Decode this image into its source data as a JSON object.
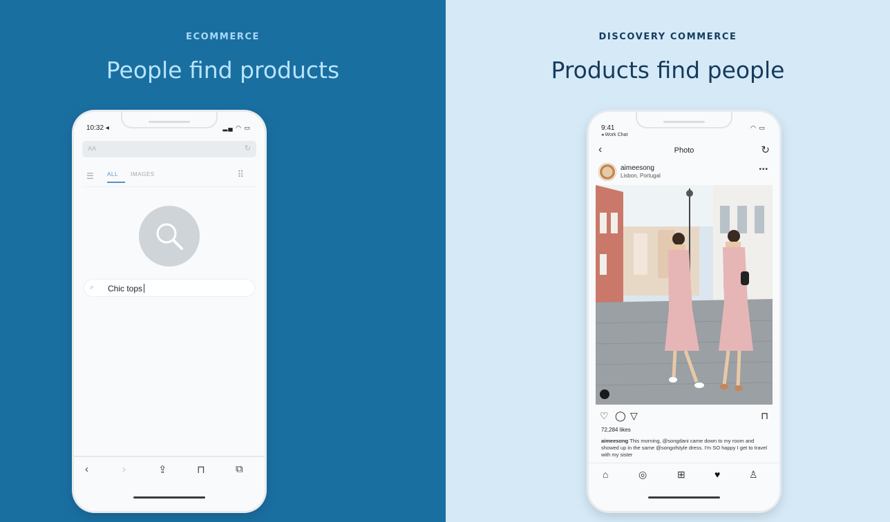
{
  "left_panel": {
    "eyebrow": "ECOMMERCE",
    "headline": "People find products",
    "phone": {
      "time": "10:32",
      "url_text": "AA",
      "tab_all": "ALL",
      "tab_images": "IMAGES",
      "query": "Chic tops"
    }
  },
  "right_panel": {
    "eyebrow": "DISCOVERY COMMERCE",
    "headline": "Products find people",
    "phone": {
      "time": "9:41",
      "back_link": "◂ Work Chat",
      "title": "Photo",
      "username": "aimeesong",
      "location": "Lisbon, Portugal",
      "likes": "72,284 likes",
      "caption_user": "aimeesong",
      "caption_text": "This morning, @songdani came down to my room and showed up in the same @songofstyle dress. I'm SO happy I get to travel with my sister"
    }
  },
  "colors": {
    "left_bg": "#1a6fa1",
    "right_bg": "#d5e9f7",
    "accent_tab": "#5b8ec9"
  },
  "icons": {
    "search": "search-icon",
    "share": "share-icon",
    "bookmarks": "bookmarks-icon",
    "tabs": "tabs-icon",
    "heart": "heart-icon",
    "comment": "comment-icon",
    "send": "send-icon",
    "save": "bookmark-icon",
    "home": "home-icon",
    "reels": "reels-icon",
    "add": "add-post-icon",
    "activity": "activity-heart-icon",
    "profile": "profile-icon"
  }
}
